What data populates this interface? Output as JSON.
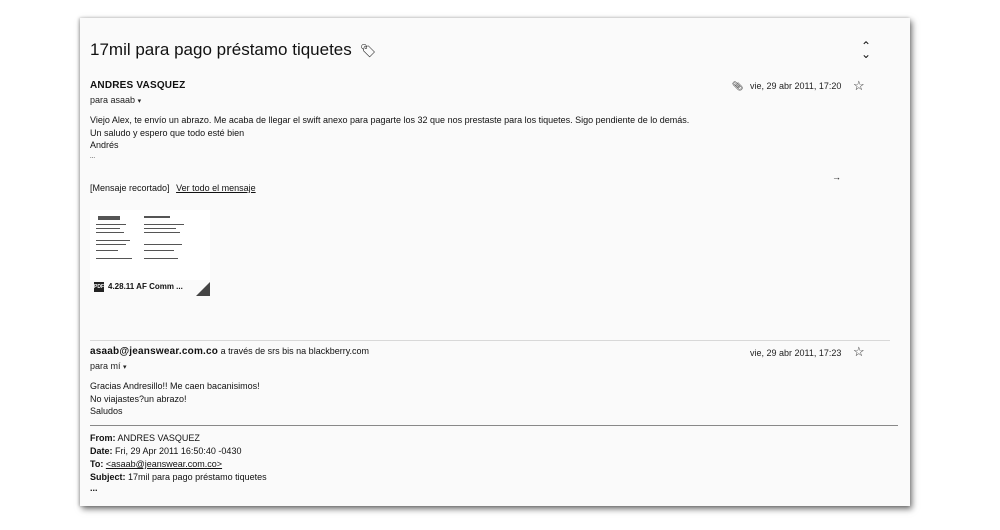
{
  "thread": {
    "subject": "17mil para pago préstamo tiquetes",
    "label_icon": "label-arrow-icon",
    "expand_icon": "expand-collapse-icon"
  },
  "message1": {
    "sender": "ANDRES VASQUEZ",
    "to": "para asaab",
    "date": "vie, 29 abr 2011, 17:20",
    "body": [
      "Viejo Alex, te envío un abrazo. Me acaba de llegar el swift anexo para pagarte los 32 que nos prestaste para los tiquetes. Sigo pendiente de lo demás.",
      "Un saludo y espero que todo esté bien",
      "Andrés",
      "..."
    ],
    "clipped_label": "[Mensaje recortado]",
    "view_full": "Ver todo el mensaje",
    "attachment": {
      "name": "4.28.11 AF Comm ...",
      "icon": "pdf-icon"
    }
  },
  "message2": {
    "sender": "asaab@jeanswear.com.co",
    "via": "a través de",
    "via_domain": "srs bis na blackberry.com",
    "to": "para mí",
    "date": "vie, 29 abr 2011, 17:23",
    "body": [
      "Gracias Andresillo!! Me caen bacanisimos!",
      "No viajastes?un abrazo!",
      "Saludos"
    ],
    "forward": {
      "from_label": "From:",
      "from": "ANDRES VASQUEZ",
      "date_label": "Date:",
      "date": "Fri, 29 Apr 2011 16:50:40 -0430",
      "to_label": "To:",
      "to": "<asaab@jeanswear.com.co>",
      "subject_label": "Subject:",
      "subject": "17mil para pago préstamo tiquetes",
      "more": "..."
    }
  }
}
